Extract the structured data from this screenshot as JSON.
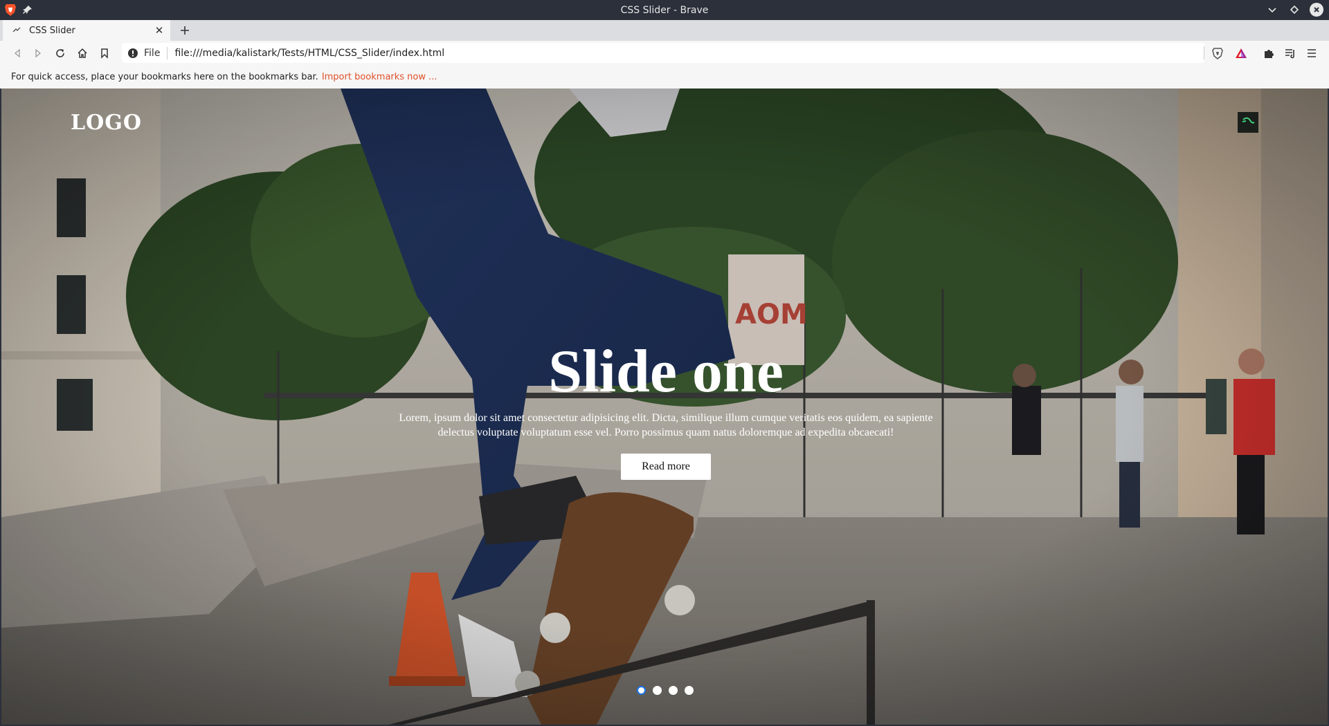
{
  "window": {
    "title": "CSS Slider - Brave"
  },
  "tabs": [
    {
      "label": "CSS Slider",
      "active": true
    }
  ],
  "toolbar": {
    "scheme_label": "File",
    "url": "file:///media/kalistark/Tests/HTML/CSS_Slider/index.html"
  },
  "bookmarks_bar": {
    "message": "For quick access, place your bookmarks here on the bookmarks bar.",
    "import_link": "Import bookmarks now ..."
  },
  "page": {
    "logo": "LOGO",
    "slide": {
      "title": "Slide one",
      "description": "Lorem, ipsum dolor sit amet consectetur adipisicing elit. Dicta, similique illum cumque veritatis eos quidem, ea sapiente delectus voluptate voluptatum esse vel. Porro possimus quam natus doloremque ad expedita obcaecati!",
      "button_label": "Read more"
    },
    "slider_dots": {
      "count": 4,
      "active_index": 0
    }
  },
  "colors": {
    "titlebar_bg": "#2b303b",
    "accent_link": "#e0502a",
    "active_dot_ring": "#1a73e8"
  },
  "icons": {
    "app": "brave-lion-icon",
    "back": "back-arrow-icon",
    "forward": "forward-arrow-icon",
    "reload": "reload-icon",
    "home": "home-icon",
    "bookmark": "bookmark-icon",
    "site_info": "info-icon",
    "shields": "brave-shields-icon",
    "rewards": "brave-rewards-icon",
    "extensions": "puzzle-icon",
    "media": "playlist-icon",
    "menu": "hamburger-menu-icon"
  }
}
